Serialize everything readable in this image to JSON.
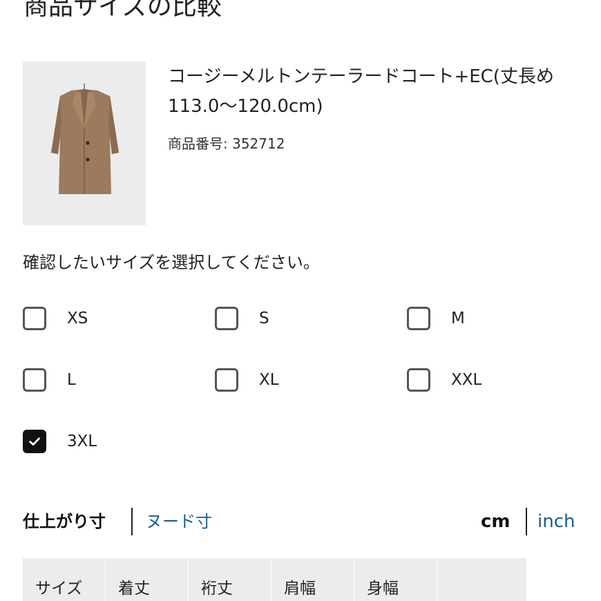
{
  "page": {
    "title": "商品サイズの比較"
  },
  "product": {
    "name": "コージーメルトンテーラードコート+EC(丈長め113.0〜120.0cm)",
    "number": "商品番号: 352712",
    "image_icon": "coat-image"
  },
  "size_selector": {
    "prompt": "確認したいサイズを選択してください。",
    "options": [
      {
        "label": "XS",
        "checked": false
      },
      {
        "label": "S",
        "checked": false
      },
      {
        "label": "M",
        "checked": false
      },
      {
        "label": "L",
        "checked": false
      },
      {
        "label": "XL",
        "checked": false
      },
      {
        "label": "XXL",
        "checked": false
      },
      {
        "label": "3XL",
        "checked": true
      }
    ]
  },
  "measure_tabs": {
    "finished": "仕上がり寸",
    "nude": "ヌード寸"
  },
  "units": {
    "cm": "cm",
    "inch": "inch"
  },
  "table": {
    "headers": [
      "サイズ",
      "着丈",
      "裄丈",
      "肩幅",
      "身幅",
      ""
    ]
  },
  "colors": {
    "link": "#1a5c8f",
    "checkbox_checked": "#111111",
    "table_header_bg": "#ececec",
    "coat": "#9c7a5e"
  }
}
